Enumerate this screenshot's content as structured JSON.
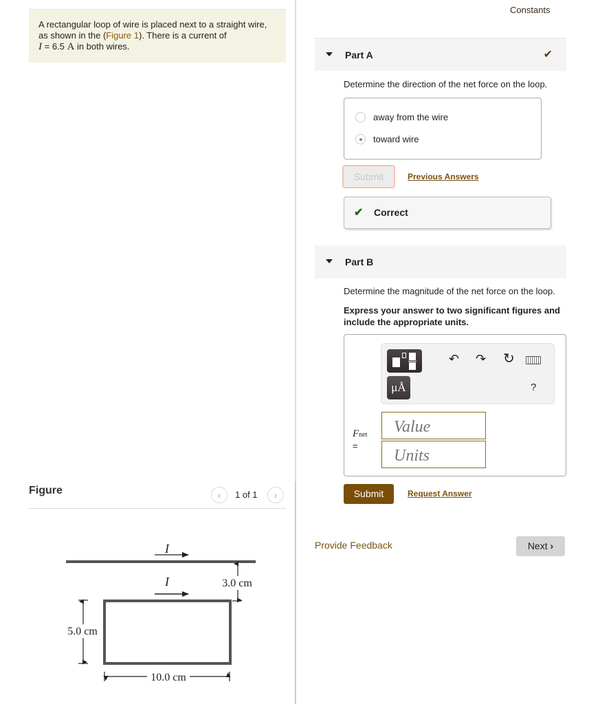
{
  "problem": {
    "text_before_link": "A rectangular loop of wire is placed next to a straight wire, as shown in the (",
    "figure_link": "Figure 1",
    "text_after_link": "). There is a current of",
    "current_symbol": "I",
    "current_equals": " = 6.5 ",
    "current_unit": "A",
    "text_end": " in both wires."
  },
  "figure": {
    "title": "Figure",
    "pager": "1 of 1",
    "prev_icon": "chevron-left-icon",
    "next_icon": "chevron-right-icon",
    "labels": {
      "current_top": "I",
      "current_loop": "I",
      "separation": "3.0 cm",
      "height": "5.0 cm",
      "width": "10.0 cm"
    }
  },
  "header": {
    "constants_link": "Constants"
  },
  "part_a": {
    "title": "Part A",
    "status_icon": "checkmark-icon",
    "question": "Determine the direction of the net force on the loop.",
    "options": [
      {
        "label": "away from the wire",
        "selected": false
      },
      {
        "label": "toward wire",
        "selected": true
      }
    ],
    "submit_label": "Submit",
    "previous_answers_label": "Previous Answers",
    "feedback_label": "Correct"
  },
  "part_b": {
    "title": "Part B",
    "question": "Determine the magnitude of the net force on the loop.",
    "instruction": "Express your answer to two significant figures and include the appropriate units.",
    "toolbar": {
      "templates_icon": "templates-icon",
      "units_label": "μÅ",
      "undo_icon": "undo-icon",
      "redo_icon": "redo-icon",
      "reset_icon": "reset-icon",
      "keyboard_icon": "keyboard-icon",
      "help_label": "?"
    },
    "variable": "F",
    "variable_sub": "net",
    "equals": "=",
    "value_placeholder": "Value",
    "units_placeholder": "Units",
    "submit_label": "Submit",
    "request_answer_label": "Request Answer"
  },
  "footer": {
    "provide_feedback": "Provide Feedback",
    "next_label": "Next",
    "next_icon": "›"
  },
  "colors": {
    "accent_brown": "#7a4e08",
    "link_brown": "#7a5312",
    "problem_bg": "#f4f2e3",
    "correct_green": "#1e6b1e"
  }
}
